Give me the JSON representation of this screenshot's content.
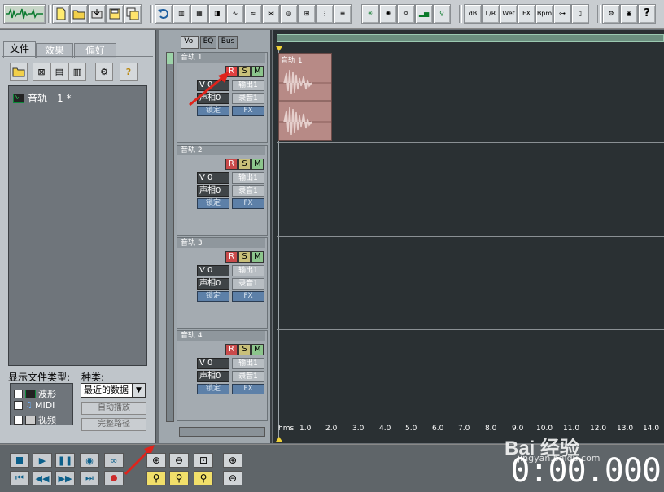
{
  "toolbar": {
    "logo_icon": "waveform-logo-icon",
    "fx_labels": {
      "db": "dB",
      "lr": "L/R",
      "wet": "Wet",
      "fx": "FX",
      "bpm": "Bpm"
    }
  },
  "left_panel": {
    "tabs": [
      {
        "label": "文件"
      },
      {
        "label": "效果"
      },
      {
        "label": "偏好"
      }
    ],
    "file_list": [
      {
        "label": "音轨　1 *"
      }
    ],
    "show_types_label": "显示文件类型:",
    "types": [
      {
        "label": "波形"
      },
      {
        "label": "MIDI"
      },
      {
        "label": "视频"
      }
    ],
    "sort_label": "种类:",
    "sort_value": "最近的数据",
    "autoplay_label": "自动播放",
    "fullpath_label": "完整路径"
  },
  "mixer": {
    "tabs": [
      {
        "label": "Vol"
      },
      {
        "label": "EQ"
      },
      {
        "label": "Bus"
      }
    ],
    "tracks": [
      {
        "title": "音轨 1",
        "r": "R",
        "s": "S",
        "m": "M",
        "vol": "V 0",
        "pan": "声相0",
        "out": "输出1",
        "rec": "录音1",
        "lock": "锁定",
        "fx": "FX"
      },
      {
        "title": "音轨 2",
        "r": "R",
        "s": "S",
        "m": "M",
        "vol": "V 0",
        "pan": "声相0",
        "out": "输出1",
        "rec": "录音1",
        "lock": "锁定",
        "fx": "FX"
      },
      {
        "title": "音轨 3",
        "r": "R",
        "s": "S",
        "m": "M",
        "vol": "V 0",
        "pan": "声相0",
        "out": "输出1",
        "rec": "录音1",
        "lock": "锁定",
        "fx": "FX"
      },
      {
        "title": "音轨 4",
        "r": "R",
        "s": "S",
        "m": "M",
        "vol": "V 0",
        "pan": "声相0",
        "out": "输出1",
        "rec": "录音1",
        "lock": "锁定",
        "fx": "FX"
      }
    ]
  },
  "timeline": {
    "clip_label": "音轨 1",
    "ruler_unit": "hms",
    "ticks": [
      "1.0",
      "2.0",
      "3.0",
      "4.0",
      "5.0",
      "6.0",
      "7.0",
      "8.0",
      "9.0",
      "10.0",
      "11.0",
      "12.0",
      "13.0",
      "14.0"
    ]
  },
  "transport": {
    "timecode": "0:00.000"
  },
  "watermark": {
    "brand": "Bai 经验",
    "url": "jingyan.baidu.com"
  },
  "colors": {
    "record_red": "#cc2a2a",
    "solo_yellow": "#c9c07a",
    "mute_green": "#8cc58c",
    "blue_button": "#5d80a8",
    "clip_fill": "#b78a86",
    "arrow_red": "#e0231b"
  }
}
